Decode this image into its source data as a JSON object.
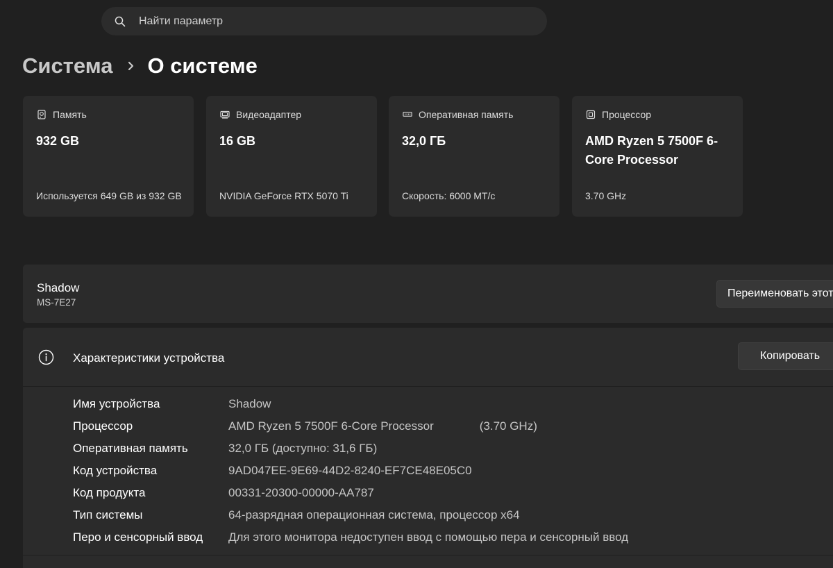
{
  "search": {
    "placeholder": "Найти параметр",
    "icon": "search-icon"
  },
  "breadcrumb": {
    "parent": "Система",
    "separator_icon": "chevron-right-icon",
    "current": "О системе"
  },
  "cards": [
    {
      "icon": "storage-icon",
      "label": "Память",
      "value": "932 GB",
      "sub": "Используется 649 GB из 932 GB"
    },
    {
      "icon": "display-adapter-icon",
      "label": "Видеоадаптер",
      "value": "16 GB",
      "sub": "NVIDIA GeForce RTX 5070 Ti"
    },
    {
      "icon": "ram-icon",
      "label": "Оперативная память",
      "value": "32,0 ГБ",
      "sub": "Скорость: 6000 MT/с"
    },
    {
      "icon": "processor-icon",
      "label": "Процессор",
      "value": "AMD Ryzen 5 7500F 6-Core Processor",
      "sub": "3.70 GHz"
    }
  ],
  "device": {
    "name": "Shadow",
    "model": "MS-7E27",
    "rename_label": "Переименовать этот компьютер"
  },
  "specs": {
    "icon": "info-icon",
    "title": "Характеристики устройства",
    "copy_label": "Копировать",
    "rows": [
      {
        "label": "Имя устройства",
        "value": "Shadow"
      },
      {
        "label": "Процессор",
        "value": "AMD Ryzen 5 7500F 6-Core Processor",
        "extra": "(3.70 GHz)"
      },
      {
        "label": "Оперативная память",
        "value": "32,0 ГБ (доступно: 31,6 ГБ)"
      },
      {
        "label": "Код устройства",
        "value": "9AD047EE-9E69-44D2-8240-EF7CE48E05C0"
      },
      {
        "label": "Код продукта",
        "value": "00331-20300-00000-AA787"
      },
      {
        "label": "Тип системы",
        "value": "64-разрядная операционная система, процессор x64"
      },
      {
        "label": "Перо и сенсорный ввод",
        "value": "Для этого монитора недоступен ввод с помощью пера и сенсорный ввод"
      }
    ]
  },
  "colors": {
    "background": "#202020",
    "card": "#2b2b2b",
    "button": "#373737"
  }
}
